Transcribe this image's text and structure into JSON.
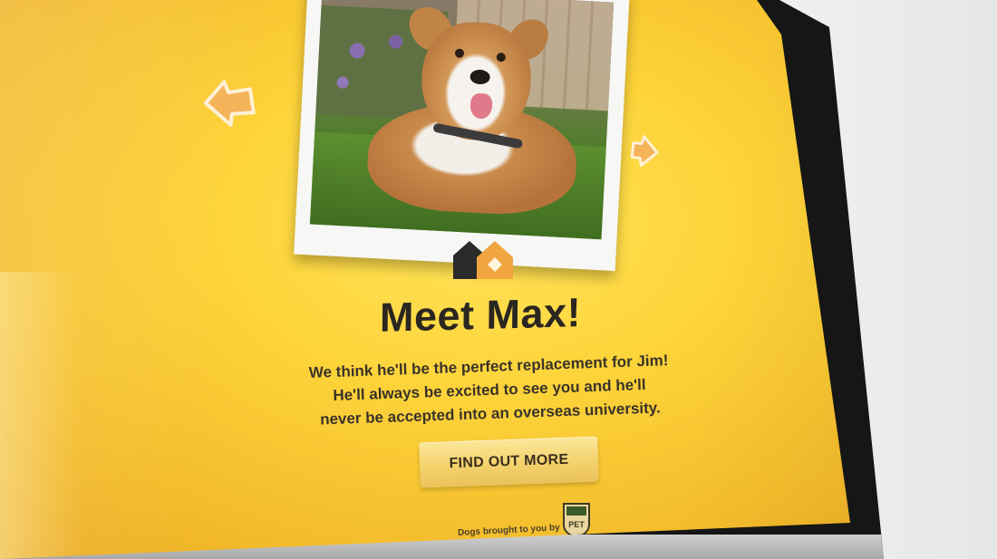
{
  "page": {
    "headline": "Meet Max!",
    "blurb_lines": [
      "We think he'll be the perfect replacement for Jim!",
      "He'll always be excited to see you and he'll",
      "never be accepted into an overseas university."
    ],
    "cta_label": "FIND OUT MORE",
    "credit": "Dogs brought to you by",
    "badge_text": "PET"
  },
  "icons": {
    "prev": "arrow-left-icon",
    "next": "arrow-right-icon",
    "logo": "house-logo-icon",
    "badge": "pet-shield-badge-icon"
  },
  "colors": {
    "background": "#fdd43a",
    "arrow_fill": "#f5b35a",
    "arrow_stroke": "#fff1d6",
    "headline": "#2b2620",
    "cta_fill": "#f4d26c",
    "logo_dark": "#2a2a2a",
    "logo_orange": "#f0a540"
  }
}
